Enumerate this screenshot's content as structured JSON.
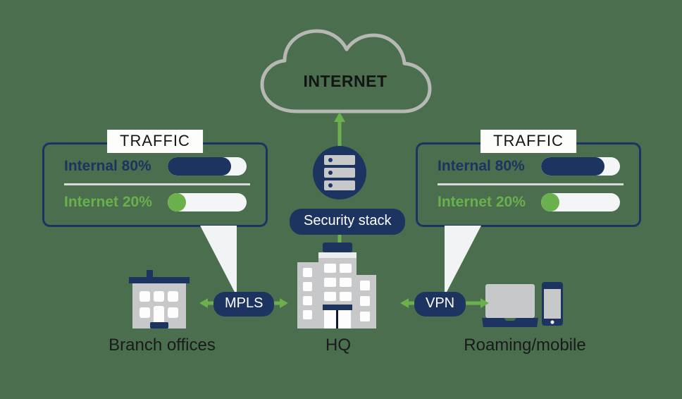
{
  "background_color": "#4a6e4e",
  "colors": {
    "navy": "#1d3461",
    "green": "#6ab04c",
    "gray": "#c6c8ca",
    "light": "#f4f5f7",
    "cloud_outline": "#b6b8b3"
  },
  "cloud": {
    "label": "INTERNET",
    "icon": "cloud-icon"
  },
  "security_stack": {
    "label": "Security stack",
    "icon": "server-stack-icon"
  },
  "panels": {
    "left": {
      "title": "TRAFFIC",
      "rows": [
        {
          "label": "Internal 80%",
          "percent": 80,
          "color": "#1d3461"
        },
        {
          "label": "Internet 20%",
          "percent": 20,
          "color": "#6ab04c"
        }
      ]
    },
    "right": {
      "title": "TRAFFIC",
      "rows": [
        {
          "label": "Internal 80%",
          "percent": 80,
          "color": "#1d3461"
        },
        {
          "label": "Internet 20%",
          "percent": 20,
          "color": "#6ab04c"
        }
      ]
    }
  },
  "links": {
    "mpls": {
      "label": "MPLS"
    },
    "vpn": {
      "label": "VPN"
    }
  },
  "nodes": {
    "branch": {
      "caption": "Branch offices",
      "icon": "office-building-icon"
    },
    "hq": {
      "caption": "HQ",
      "icon": "hq-building-icon"
    },
    "roaming": {
      "caption": "Roaming/mobile",
      "icon": "laptop-phone-icon"
    }
  }
}
